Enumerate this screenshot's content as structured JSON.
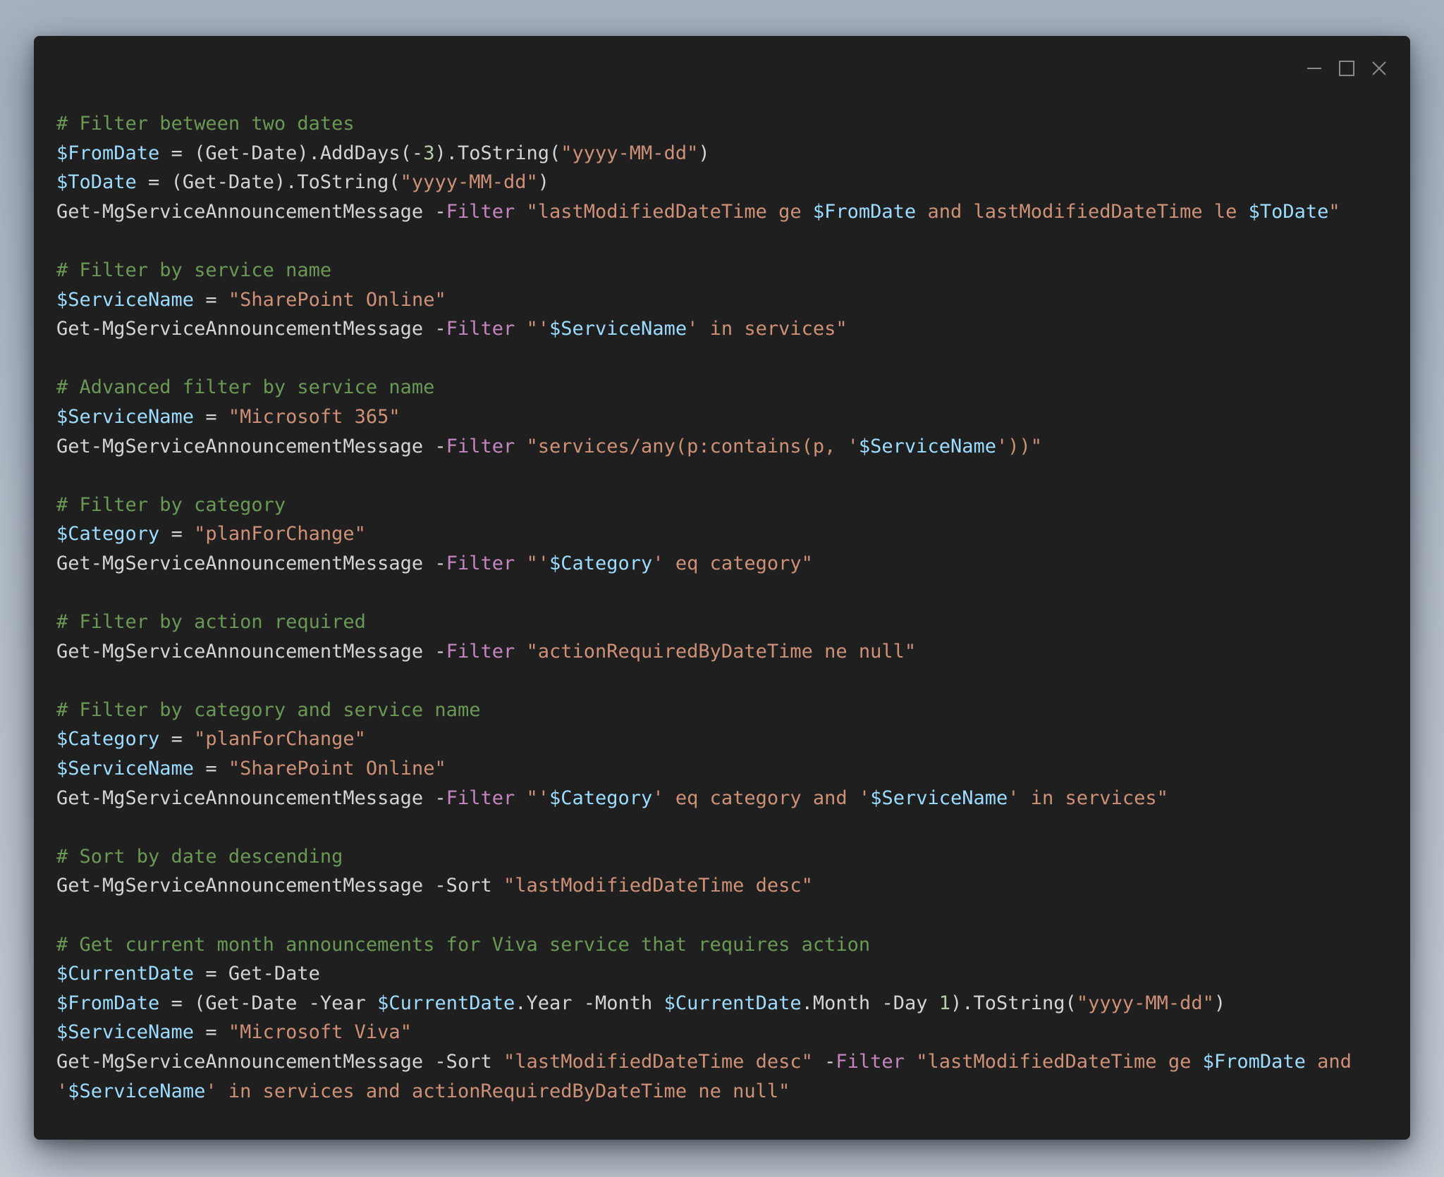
{
  "window": {
    "controls": [
      {
        "name": "minimize",
        "icon": "minimize-icon"
      },
      {
        "name": "maximize",
        "icon": "maximize-icon"
      },
      {
        "name": "close",
        "icon": "close-icon"
      }
    ]
  },
  "theme": {
    "background": "#1f1f1f",
    "comment": "#6a9955",
    "variable": "#9cdcfe",
    "string": "#ce9178",
    "parameter": "#c586c0",
    "number": "#b5cea8",
    "text": "#d4d4d4"
  },
  "code": [
    [
      {
        "k": "c",
        "t": "# Filter between two dates"
      }
    ],
    [
      {
        "k": "v",
        "t": "$FromDate"
      },
      {
        "k": "t",
        "t": " = (Get-Date).AddDays(-"
      },
      {
        "k": "n",
        "t": "3"
      },
      {
        "k": "t",
        "t": ").ToString("
      },
      {
        "k": "s",
        "t": "\"yyyy-MM-dd\""
      },
      {
        "k": "t",
        "t": ")"
      }
    ],
    [
      {
        "k": "v",
        "t": "$ToDate"
      },
      {
        "k": "t",
        "t": " = (Get-Date).ToString("
      },
      {
        "k": "s",
        "t": "\"yyyy-MM-dd\""
      },
      {
        "k": "t",
        "t": ")"
      }
    ],
    [
      {
        "k": "t",
        "t": "Get-MgServiceAnnouncementMessage -"
      },
      {
        "k": "p",
        "t": "Filter"
      },
      {
        "k": "t",
        "t": " "
      },
      {
        "k": "s",
        "t": "\"lastModifiedDateTime ge "
      },
      {
        "k": "v",
        "t": "$FromDate"
      },
      {
        "k": "s",
        "t": " and lastModifiedDateTime le "
      },
      {
        "k": "v",
        "t": "$ToDate"
      },
      {
        "k": "s",
        "t": "\""
      }
    ],
    [],
    [
      {
        "k": "c",
        "t": "# Filter by service name"
      }
    ],
    [
      {
        "k": "v",
        "t": "$ServiceName"
      },
      {
        "k": "t",
        "t": " = "
      },
      {
        "k": "s",
        "t": "\"SharePoint Online\""
      }
    ],
    [
      {
        "k": "t",
        "t": "Get-MgServiceAnnouncementMessage -"
      },
      {
        "k": "p",
        "t": "Filter"
      },
      {
        "k": "t",
        "t": " "
      },
      {
        "k": "s",
        "t": "\"'"
      },
      {
        "k": "v",
        "t": "$ServiceName"
      },
      {
        "k": "s",
        "t": "' in services\""
      }
    ],
    [],
    [
      {
        "k": "c",
        "t": "# Advanced filter by service name"
      }
    ],
    [
      {
        "k": "v",
        "t": "$ServiceName"
      },
      {
        "k": "t",
        "t": " = "
      },
      {
        "k": "s",
        "t": "\"Microsoft 365\""
      }
    ],
    [
      {
        "k": "t",
        "t": "Get-MgServiceAnnouncementMessage -"
      },
      {
        "k": "p",
        "t": "Filter"
      },
      {
        "k": "t",
        "t": " "
      },
      {
        "k": "s",
        "t": "\"services/any(p:contains(p, '"
      },
      {
        "k": "v",
        "t": "$ServiceName"
      },
      {
        "k": "s",
        "t": "'))\""
      }
    ],
    [],
    [
      {
        "k": "c",
        "t": "# Filter by category"
      }
    ],
    [
      {
        "k": "v",
        "t": "$Category"
      },
      {
        "k": "t",
        "t": " = "
      },
      {
        "k": "s",
        "t": "\"planForChange\""
      }
    ],
    [
      {
        "k": "t",
        "t": "Get-MgServiceAnnouncementMessage -"
      },
      {
        "k": "p",
        "t": "Filter"
      },
      {
        "k": "t",
        "t": " "
      },
      {
        "k": "s",
        "t": "\"'"
      },
      {
        "k": "v",
        "t": "$Category"
      },
      {
        "k": "s",
        "t": "' eq category\""
      }
    ],
    [],
    [
      {
        "k": "c",
        "t": "# Filter by action required"
      }
    ],
    [
      {
        "k": "t",
        "t": "Get-MgServiceAnnouncementMessage -"
      },
      {
        "k": "p",
        "t": "Filter"
      },
      {
        "k": "t",
        "t": " "
      },
      {
        "k": "s",
        "t": "\"actionRequiredByDateTime ne null\""
      }
    ],
    [],
    [
      {
        "k": "c",
        "t": "# Filter by category and service name"
      }
    ],
    [
      {
        "k": "v",
        "t": "$Category"
      },
      {
        "k": "t",
        "t": " = "
      },
      {
        "k": "s",
        "t": "\"planForChange\""
      }
    ],
    [
      {
        "k": "v",
        "t": "$ServiceName"
      },
      {
        "k": "t",
        "t": " = "
      },
      {
        "k": "s",
        "t": "\"SharePoint Online\""
      }
    ],
    [
      {
        "k": "t",
        "t": "Get-MgServiceAnnouncementMessage -"
      },
      {
        "k": "p",
        "t": "Filter"
      },
      {
        "k": "t",
        "t": " "
      },
      {
        "k": "s",
        "t": "\"'"
      },
      {
        "k": "v",
        "t": "$Category"
      },
      {
        "k": "s",
        "t": "' eq category and '"
      },
      {
        "k": "v",
        "t": "$ServiceName"
      },
      {
        "k": "s",
        "t": "' in services\""
      }
    ],
    [],
    [
      {
        "k": "c",
        "t": "# Sort by date descending"
      }
    ],
    [
      {
        "k": "t",
        "t": "Get-MgServiceAnnouncementMessage -Sort "
      },
      {
        "k": "s",
        "t": "\"lastModifiedDateTime desc\""
      }
    ],
    [],
    [
      {
        "k": "c",
        "t": "# Get current month announcements for Viva service that requires action"
      }
    ],
    [
      {
        "k": "v",
        "t": "$CurrentDate"
      },
      {
        "k": "t",
        "t": " = Get-Date"
      }
    ],
    [
      {
        "k": "v",
        "t": "$FromDate"
      },
      {
        "k": "t",
        "t": " = (Get-Date -Year "
      },
      {
        "k": "v",
        "t": "$CurrentDate"
      },
      {
        "k": "t",
        "t": ".Year -Month "
      },
      {
        "k": "v",
        "t": "$CurrentDate"
      },
      {
        "k": "t",
        "t": ".Month -Day "
      },
      {
        "k": "n",
        "t": "1"
      },
      {
        "k": "t",
        "t": ").ToString("
      },
      {
        "k": "s",
        "t": "\"yyyy-MM-dd\""
      },
      {
        "k": "t",
        "t": ")"
      }
    ],
    [
      {
        "k": "v",
        "t": "$ServiceName"
      },
      {
        "k": "t",
        "t": " = "
      },
      {
        "k": "s",
        "t": "\"Microsoft Viva\""
      }
    ],
    [
      {
        "k": "t",
        "t": "Get-MgServiceAnnouncementMessage -Sort "
      },
      {
        "k": "s",
        "t": "\"lastModifiedDateTime desc\""
      },
      {
        "k": "t",
        "t": " -"
      },
      {
        "k": "p",
        "t": "Filter"
      },
      {
        "k": "t",
        "t": " "
      },
      {
        "k": "s",
        "t": "\"lastModifiedDateTime ge "
      },
      {
        "k": "v",
        "t": "$FromDate"
      },
      {
        "k": "s",
        "t": " and"
      }
    ],
    [
      {
        "k": "s",
        "t": "'"
      },
      {
        "k": "v",
        "t": "$ServiceName"
      },
      {
        "k": "s",
        "t": "' in services and actionRequiredByDateTime ne null\""
      }
    ]
  ]
}
